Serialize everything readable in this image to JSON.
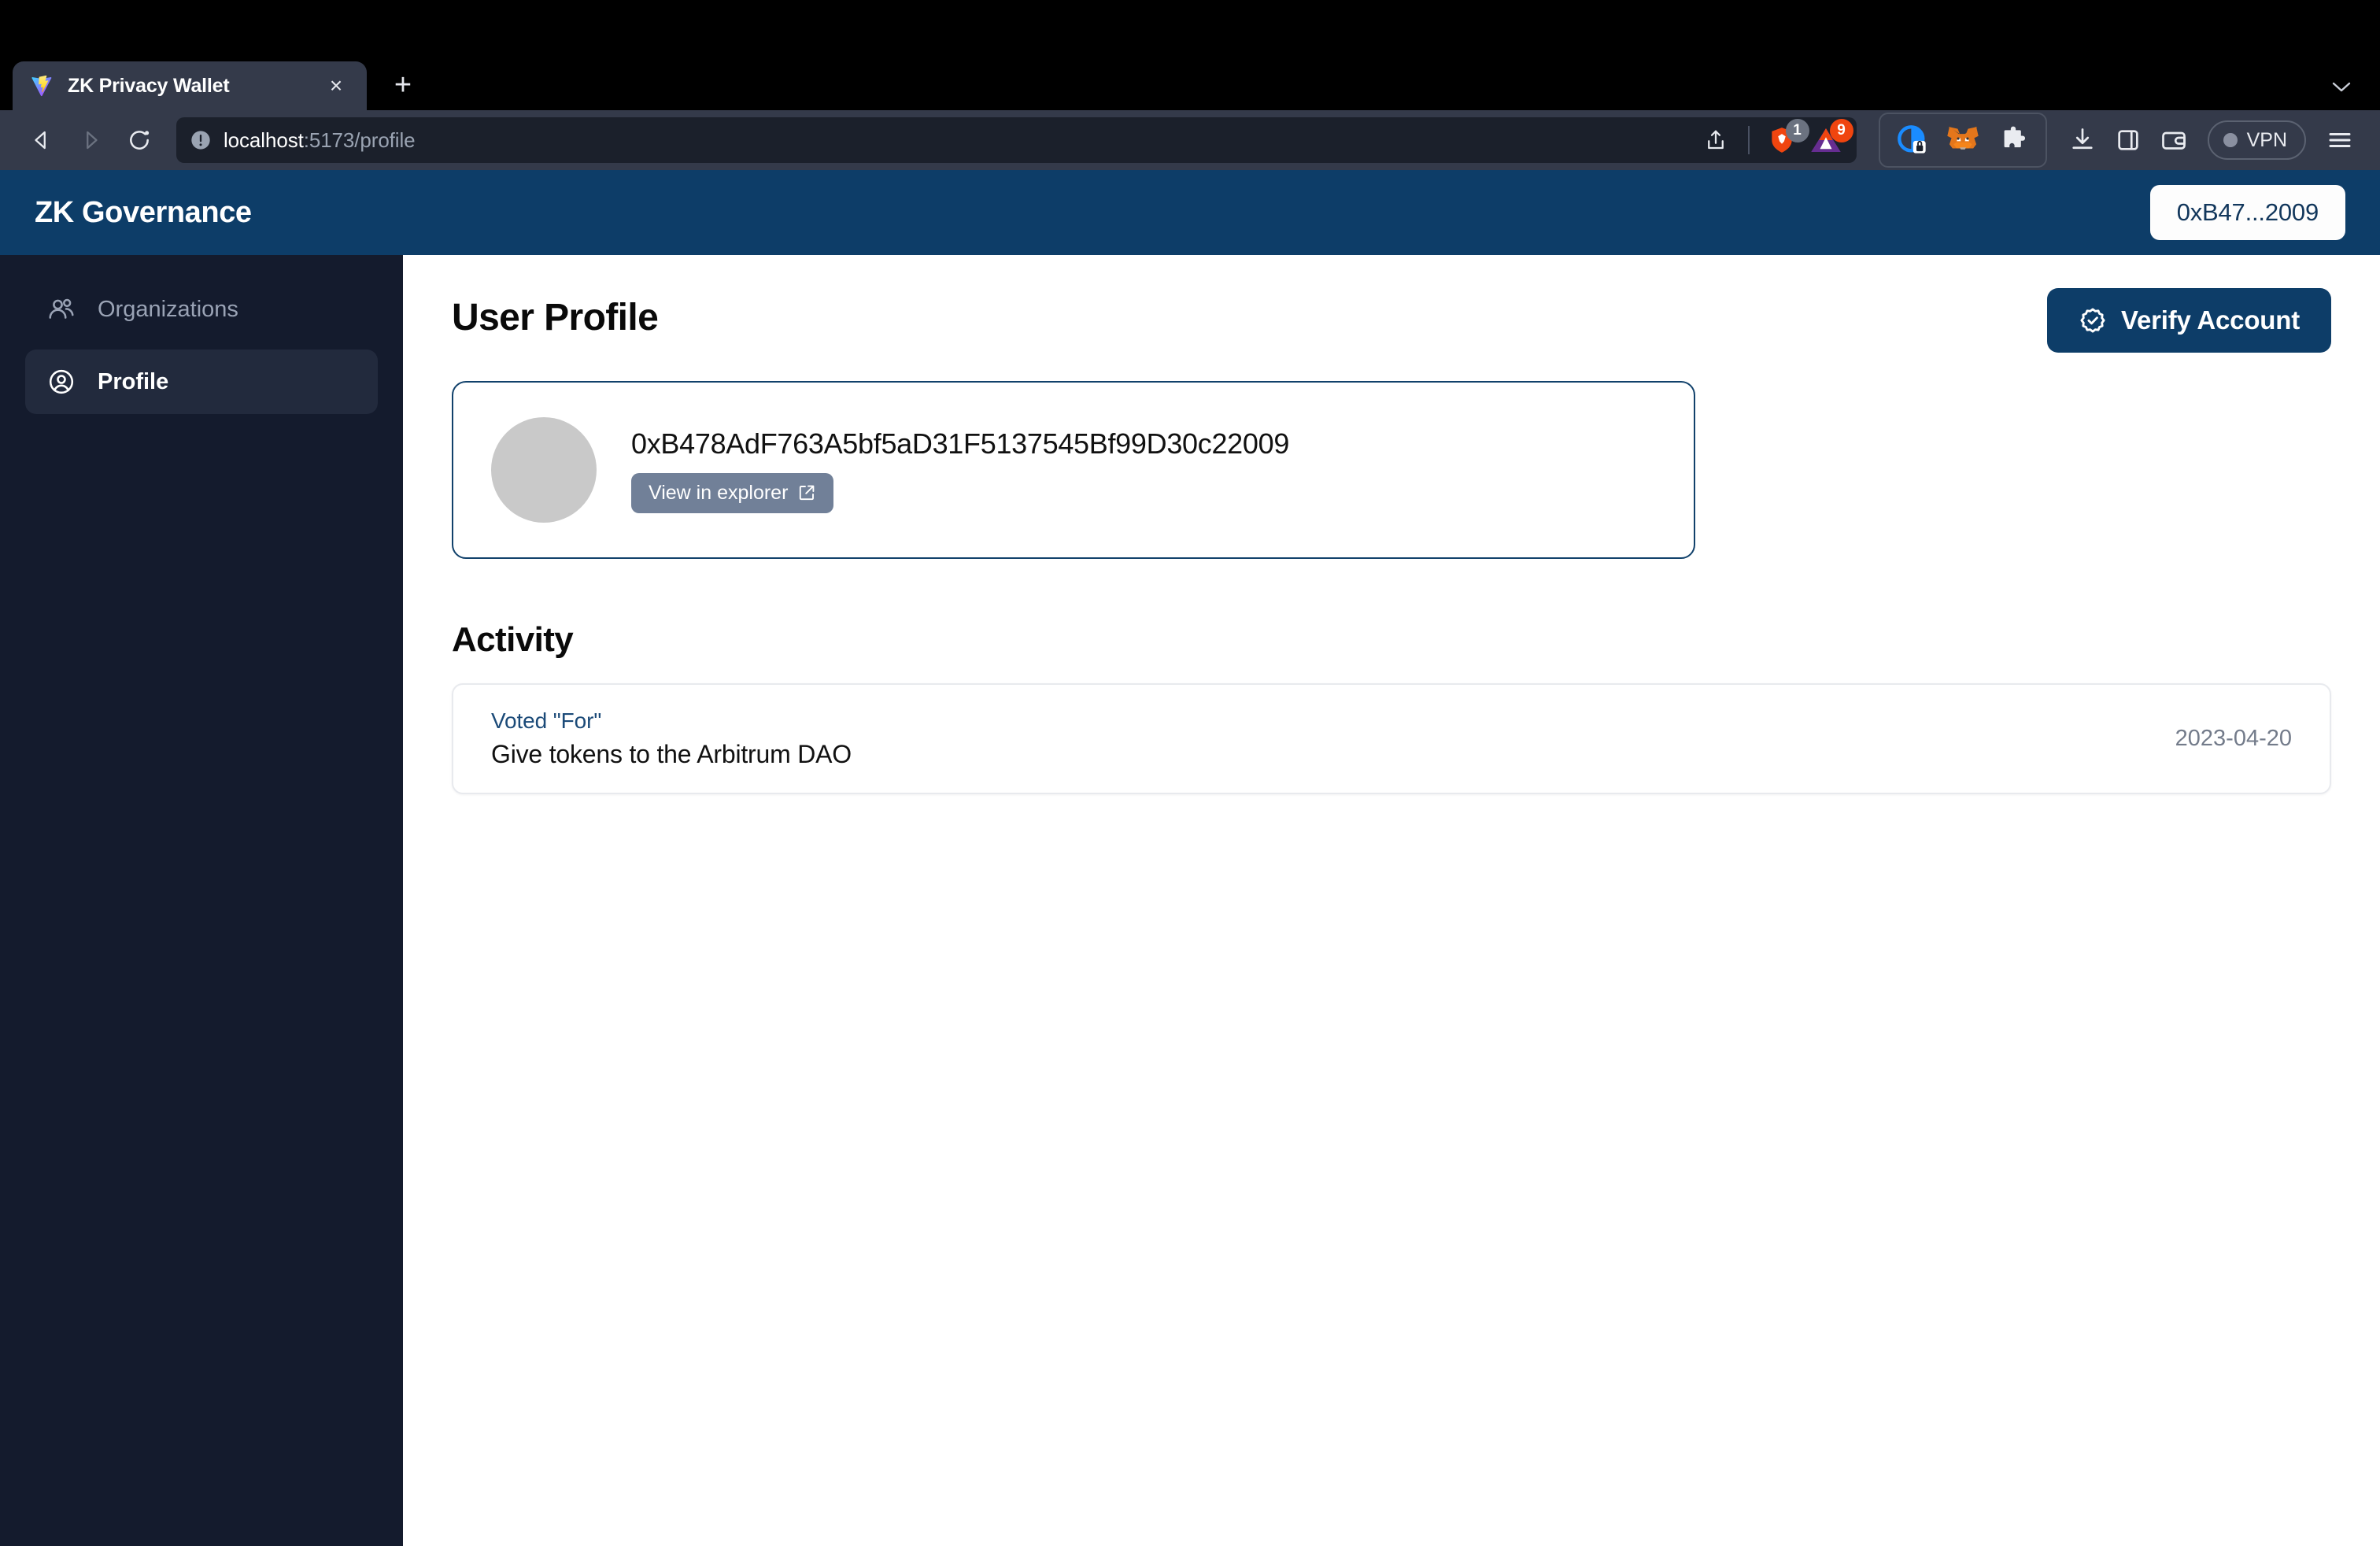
{
  "browser": {
    "tab": {
      "title": "ZK Privacy Wallet",
      "favicon_name": "vite-logo-icon",
      "close_label": "×"
    },
    "new_tab_label": "+",
    "tab_list_chevron": "⌄",
    "nav": {
      "back": "back-arrow",
      "forward": "forward-arrow",
      "reload": "reload-arrow"
    },
    "url": {
      "host": "localhost",
      "path": ":5173/profile",
      "full": "localhost:5173/profile",
      "security_state": "not-secure"
    },
    "url_actions": {
      "share": "share-icon",
      "shield_badge_count": "1",
      "rewards_badge_count": "9"
    },
    "toolbar": {
      "extensions": [
        "privacy-badger-icon",
        "metamask-fox-icon",
        "puzzle-extensions-icon"
      ],
      "downloads": "download-icon",
      "sidebar": "sidebar-panel-icon",
      "wallet": "wallet-icon",
      "vpn_label": "VPN",
      "menu": "hamburger-menu-icon"
    }
  },
  "app": {
    "brand": "ZK Governance",
    "wallet_address_short": "0xB47...2009",
    "sidebar": {
      "items": [
        {
          "label": "Organizations",
          "icon": "users-icon",
          "active": false
        },
        {
          "label": "Profile",
          "icon": "user-circle-icon",
          "active": true
        }
      ]
    },
    "page": {
      "title": "User Profile",
      "verify_button": "Verify Account",
      "verify_icon": "badge-check-icon",
      "profile": {
        "address": "0xB478AdF763A5bf5aD31F5137545Bf99D30c22009",
        "explorer_button": "View in explorer",
        "explorer_icon": "external-link-icon",
        "avatar": "blank-avatar"
      },
      "activity": {
        "title": "Activity",
        "items": [
          {
            "kind": "Voted \"For\"",
            "description": "Give tokens to the Arbitrum DAO",
            "date": "2023-04-20"
          }
        ]
      }
    }
  },
  "colors": {
    "header_navy": "#0d3d68",
    "sidebar_navy": "#141b2d",
    "accent_link": "#1b4a78",
    "explorer_btn": "#718098"
  }
}
